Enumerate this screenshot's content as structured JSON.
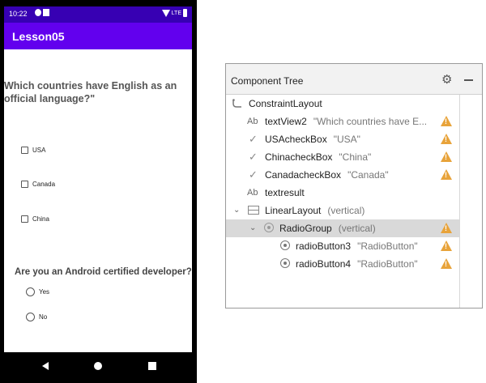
{
  "phone": {
    "status": {
      "time": "10:22",
      "network": "LTE"
    },
    "app_title": "Lesson05",
    "question1": "Which countries have English as an official language?\"",
    "checkboxes": [
      {
        "label": "USA"
      },
      {
        "label": "Canada"
      },
      {
        "label": "China"
      }
    ],
    "question2": "Are you an Android certified developer?",
    "radios": [
      {
        "label": "Yes"
      },
      {
        "label": "No"
      }
    ]
  },
  "component_tree": {
    "title": "Component Tree",
    "rows": [
      {
        "icon": "constraint-layout-icon",
        "name": "ConstraintLayout",
        "detail": "",
        "warning": false
      },
      {
        "icon": "textview-icon",
        "name": "textView2",
        "detail": "\"Which countries have E...",
        "warning": true
      },
      {
        "icon": "checkbox-icon",
        "name": "USAcheckBox",
        "detail": "\"USA\"",
        "warning": true
      },
      {
        "icon": "checkbox-icon",
        "name": "ChinacheckBox",
        "detail": "\"China\"",
        "warning": true
      },
      {
        "icon": "checkbox-icon",
        "name": "CanadacheckBox",
        "detail": "\"Canada\"",
        "warning": true
      },
      {
        "icon": "textview-icon",
        "name": "textresult",
        "detail": "",
        "warning": false
      },
      {
        "icon": "linear-layout-icon",
        "name": "LinearLayout",
        "detail": "(vertical)",
        "warning": false
      },
      {
        "icon": "radio-group-icon",
        "name": "RadioGroup",
        "detail": "(vertical)",
        "warning": true
      },
      {
        "icon": "radio-button-icon",
        "name": "radioButton3",
        "detail": "\"RadioButton\"",
        "warning": true
      },
      {
        "icon": "radio-button-icon",
        "name": "radioButton4",
        "detail": "\"RadioButton\"",
        "warning": true
      }
    ],
    "textview_glyph": "Ab",
    "colors": {
      "warning": "#e8a33a",
      "selected_row": "#d9d9d9"
    }
  },
  "colors": {
    "status_bar": "#3700B3",
    "app_bar": "#6200EE"
  }
}
